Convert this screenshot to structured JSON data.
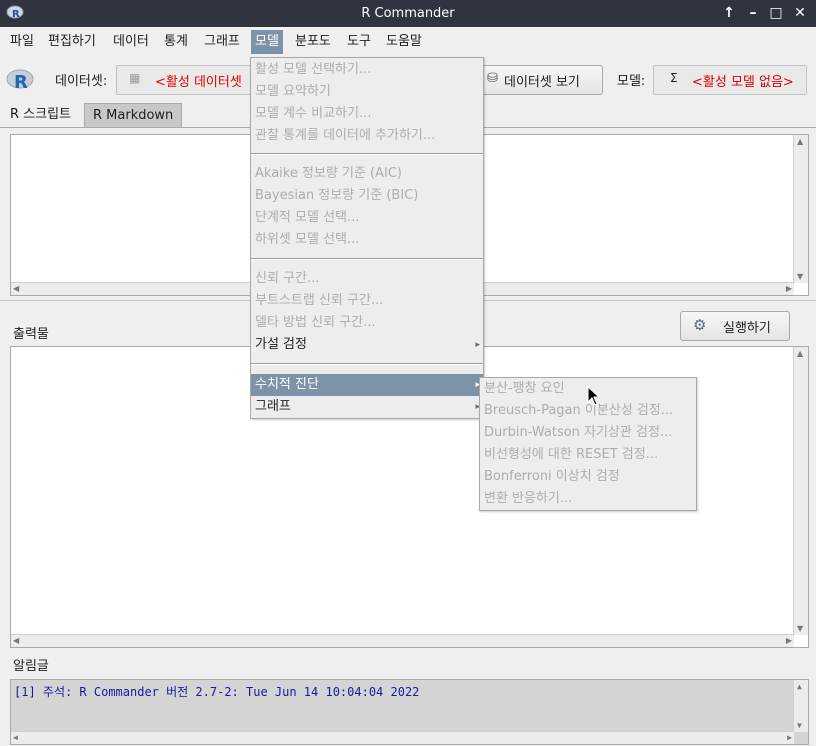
{
  "window": {
    "title": "R Commander"
  },
  "menubar": [
    "파일",
    "편집하기",
    "데이터",
    "통계",
    "그래프",
    "모델",
    "분포도",
    "도구",
    "도움말"
  ],
  "toolbar": {
    "dataset_label": "데이터셋:",
    "dataset_value": "<활성 데이터셋",
    "view_dataset_button": "데이터셋 보기",
    "model_label": "모델:",
    "model_value": "<활성 모델 없음>"
  },
  "tabs": [
    "R 스크립트",
    "R Markdown"
  ],
  "output": {
    "label": "출력물",
    "run_button": "실행하기"
  },
  "messages": {
    "label": "알림글",
    "line": "[1] 주석: R Commander 버전 2.7-2: Tue Jun 14 10:04:04 2022"
  },
  "model_menu": [
    "활성 모델 선택하기...",
    "모델 요약하기",
    "모델 계수 비교하기...",
    "관찰 통계를 데이터에 추가하기...",
    "Akaike 정보량 기준 (AIC)",
    "Bayesian 정보량 기준 (BIC)",
    "단계적 모델 선택...",
    "하위셋 모델 선택...",
    "신뢰 구간...",
    "부트스트랩 신뢰 구간...",
    "델타 방법 신뢰 구간...",
    "가설 검정",
    "수치적 진단",
    "그래프"
  ],
  "diagnostics_submenu": [
    "분산-팽창 요인",
    "Breusch-Pagan 이분산성 검정...",
    "Durbin-Watson 자기상관 검정...",
    "비선형성에 대한 RESET 검정...",
    "Bonferroni 이상치 검정",
    "변환 반응하기..."
  ],
  "colors": {
    "titlebar": "#2f343f",
    "highlight": "#7d93a8",
    "warning": "#e00000",
    "message_text": "#1a1aa0"
  }
}
